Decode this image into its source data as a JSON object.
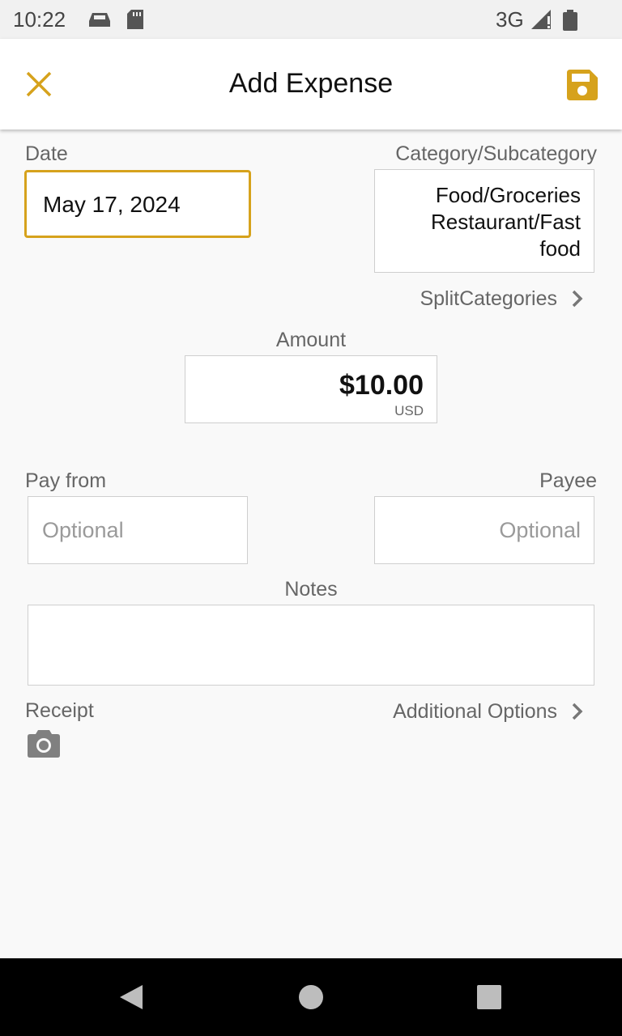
{
  "status": {
    "time": "10:22",
    "network": "3G",
    "icons": [
      "car-icon",
      "sd-card-icon",
      "signal-icon",
      "battery-icon"
    ]
  },
  "appbar": {
    "title": "Add Expense",
    "close_icon": "close-icon",
    "save_icon": "save-icon",
    "accent": "#d6a21c"
  },
  "form": {
    "date_label": "Date",
    "date_value": "May 17, 2024",
    "category_label": "Category/Subcategory",
    "category_lines": [
      "Food/Groceries",
      "Restaurant/Fast",
      "food"
    ],
    "split_label": "SplitCategories",
    "amount_label": "Amount",
    "amount_value": "$10.00",
    "currency": "USD",
    "pay_from_label": "Pay from",
    "pay_from_placeholder": "Optional",
    "payee_label": "Payee",
    "payee_placeholder": "Optional",
    "notes_label": "Notes",
    "receipt_label": "Receipt",
    "additional_label": "Additional Options"
  }
}
